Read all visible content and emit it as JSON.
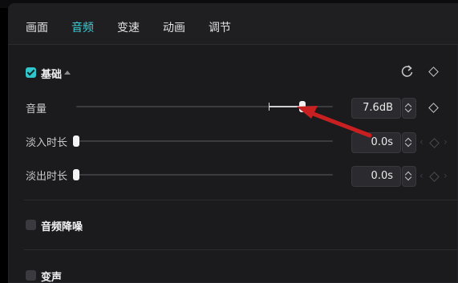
{
  "tabs": [
    {
      "label": "画面"
    },
    {
      "label": "音频"
    },
    {
      "label": "变速"
    },
    {
      "label": "动画"
    },
    {
      "label": "调节"
    }
  ],
  "active_tab": "音频",
  "basic": {
    "title": "基础",
    "checked": true,
    "volume": {
      "label": "音量",
      "value": "7.6dB",
      "level_fraction": 0.88
    },
    "fade_in": {
      "label": "淡入时长",
      "value": "0.0s",
      "level_fraction": 0.0
    },
    "fade_out": {
      "label": "淡出时长",
      "value": "0.0s",
      "level_fraction": 0.0
    }
  },
  "noise_reduction": {
    "label": "音频降噪",
    "checked": false
  },
  "voice_change": {
    "label": "变声",
    "checked": false
  },
  "icons": {
    "reset": "reset-icon",
    "keyframe": "keyframe-diamond-icon",
    "annotation": "red-arrow-annotation"
  },
  "colors": {
    "accent": "#3cd0d8",
    "annotation": "#c82020"
  }
}
